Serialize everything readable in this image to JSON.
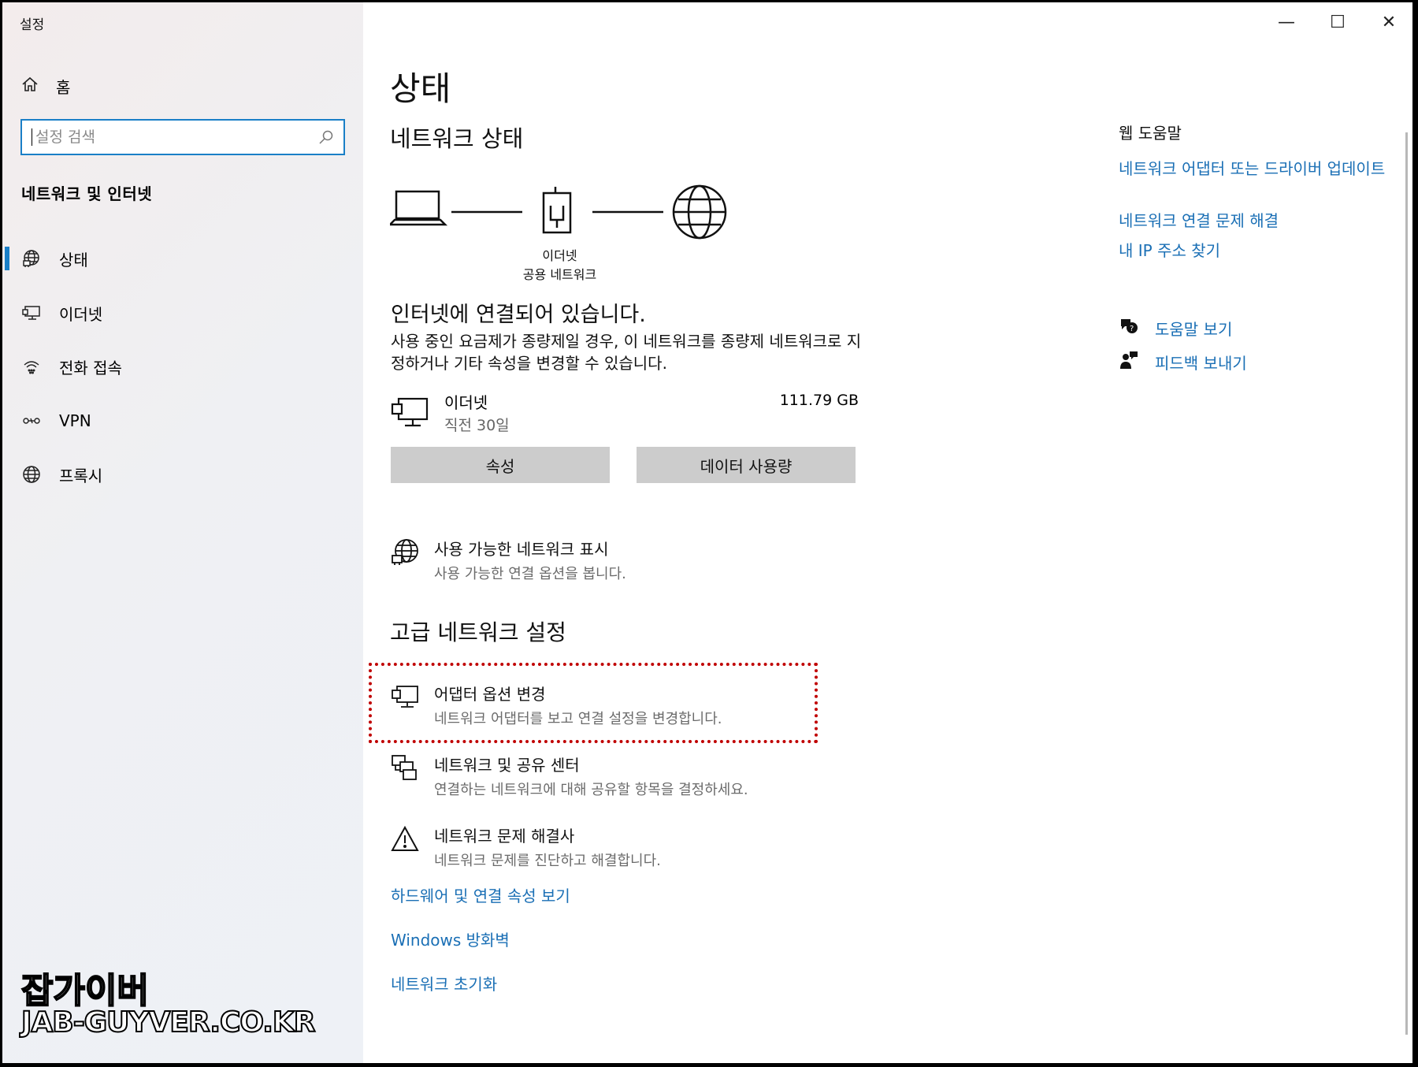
{
  "window": {
    "app_title": "설정",
    "minimize": "—",
    "maximize": "☐",
    "close": "✕"
  },
  "sidebar": {
    "home_label": "홈",
    "search_placeholder": "설정 검색",
    "section_title": "네트워크 및 인터넷",
    "items": [
      {
        "label": "상태",
        "icon": "globe-network-icon",
        "active": true
      },
      {
        "label": "이더넷",
        "icon": "ethernet-icon"
      },
      {
        "label": "전화 접속",
        "icon": "dialup-icon"
      },
      {
        "label": "VPN",
        "icon": "vpn-icon"
      },
      {
        "label": "프록시",
        "icon": "globe-icon"
      }
    ]
  },
  "watermark": {
    "line1": "잡가이버",
    "line2": "JAB-GUYVER.CO.KR"
  },
  "main": {
    "page_title": "상태",
    "network_status_heading": "네트워크 상태",
    "diagram": {
      "label1": "이더넷",
      "label2": "공용 네트워크"
    },
    "connected_text": "인터넷에 연결되어 있습니다.",
    "desc": "사용 중인 요금제가 종량제일 경우, 이 네트워크를 종량제 네트워크로 지정하거나 기타 속성을 변경할 수 있습니다.",
    "ethernet": {
      "name": "이더넷",
      "sub": "직전 30일",
      "size": "111.79 GB"
    },
    "buttons": {
      "properties": "속성",
      "data_usage": "데이터 사용량"
    },
    "show_networks": {
      "title": "사용 가능한 네트워크 표시",
      "sub": "사용 가능한 연결 옵션을 봅니다."
    },
    "advanced_heading": "고급 네트워크 설정",
    "advanced": [
      {
        "title": "어댑터 옵션 변경",
        "sub": "네트워크 어댑터를 보고 연결 설정을 변경합니다."
      },
      {
        "title": "네트워크 및 공유 센터",
        "sub": "연결하는 네트워크에 대해 공유할 항목을 결정하세요."
      },
      {
        "title": "네트워크 문제 해결사",
        "sub": "네트워크 문제를 진단하고 해결합니다."
      }
    ],
    "links": {
      "hardware": "하드웨어 및 연결 속성 보기",
      "firewall": "Windows 방화벽",
      "reset": "네트워크 초기화"
    }
  },
  "right_panel": {
    "title": "웹 도움말",
    "links": [
      "네트워크 어댑터 또는 드라이버 업데이트",
      "네트워크 연결 문제 해결",
      "내 IP 주소 찾기"
    ],
    "help": "도움말 보기",
    "feedback": "피드백 보내기"
  },
  "colors": {
    "accent": "#1a7fc7",
    "link": "#1a6fb5",
    "highlight": "#c00000",
    "button": "#cccccc"
  }
}
